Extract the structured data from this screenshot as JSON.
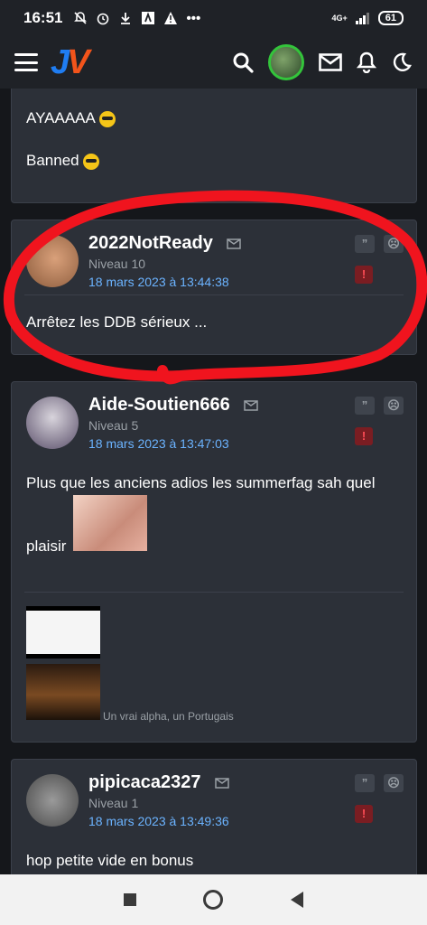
{
  "status": {
    "time": "16:51",
    "network": "4G+",
    "battery": "61"
  },
  "topbar": {
    "logo_j": "J",
    "logo_v": "V"
  },
  "posts": [
    {
      "lines": [
        "AYAAAAA",
        "Banned"
      ]
    },
    {
      "author": "2022NotReady",
      "level": "Niveau 10",
      "date": "18 mars 2023 à 13:44:38",
      "body": "Arrêtez les DDB sérieux ..."
    },
    {
      "author": "Aide-Soutien666",
      "level": "Niveau 5",
      "date": "18 mars 2023 à 13:47:03",
      "body_line1": "Plus que les anciens adios les summerfag sah quel",
      "body_line2": "plaisir",
      "caption": "Un vrai alpha, un Portugais"
    },
    {
      "author": "pipicaca2327",
      "level": "Niveau 1",
      "date": "18 mars 2023 à 13:49:36",
      "body": "hop petite vide en bonus"
    }
  ],
  "icons": {
    "quote": "”",
    "alert": "!"
  },
  "colors": {
    "accent_link": "#6bb3ff",
    "annotation_red": "#f0141e"
  }
}
